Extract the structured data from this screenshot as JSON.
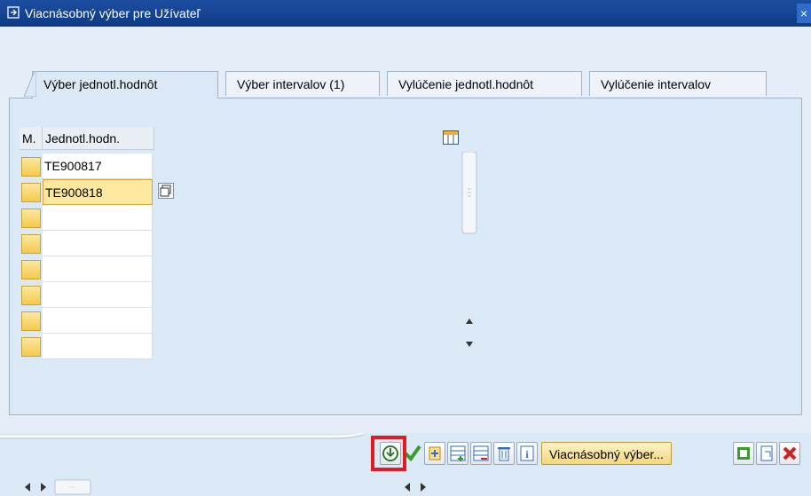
{
  "window": {
    "title": "Viacnásobný výber pre Užívateľ",
    "close_label": "×"
  },
  "tabs": [
    {
      "label": "Výber jednotl.hodnôt",
      "active": true
    },
    {
      "label": "Výber intervalov (1)",
      "active": false
    },
    {
      "label": "Vylúčenie jednotl.hodnôt",
      "active": false
    },
    {
      "label": "Vylúčenie intervalov",
      "active": false
    }
  ],
  "table": {
    "col_select_header": "M.",
    "col_value_header": "Jednotl.hodn.",
    "rows": [
      "TE900817",
      "TE900818",
      "",
      "",
      "",
      "",
      "",
      ""
    ]
  },
  "toolbar": {
    "multiple_selection_label": "Viacnásobný výber...",
    "icons": [
      "execute-icon",
      "check-icon",
      "insert-line-icon",
      "add-row-icon",
      "delete-row-icon",
      "trash-icon",
      "info-icon",
      "copy-icon",
      "import-icon",
      "cancel-icon"
    ]
  }
}
